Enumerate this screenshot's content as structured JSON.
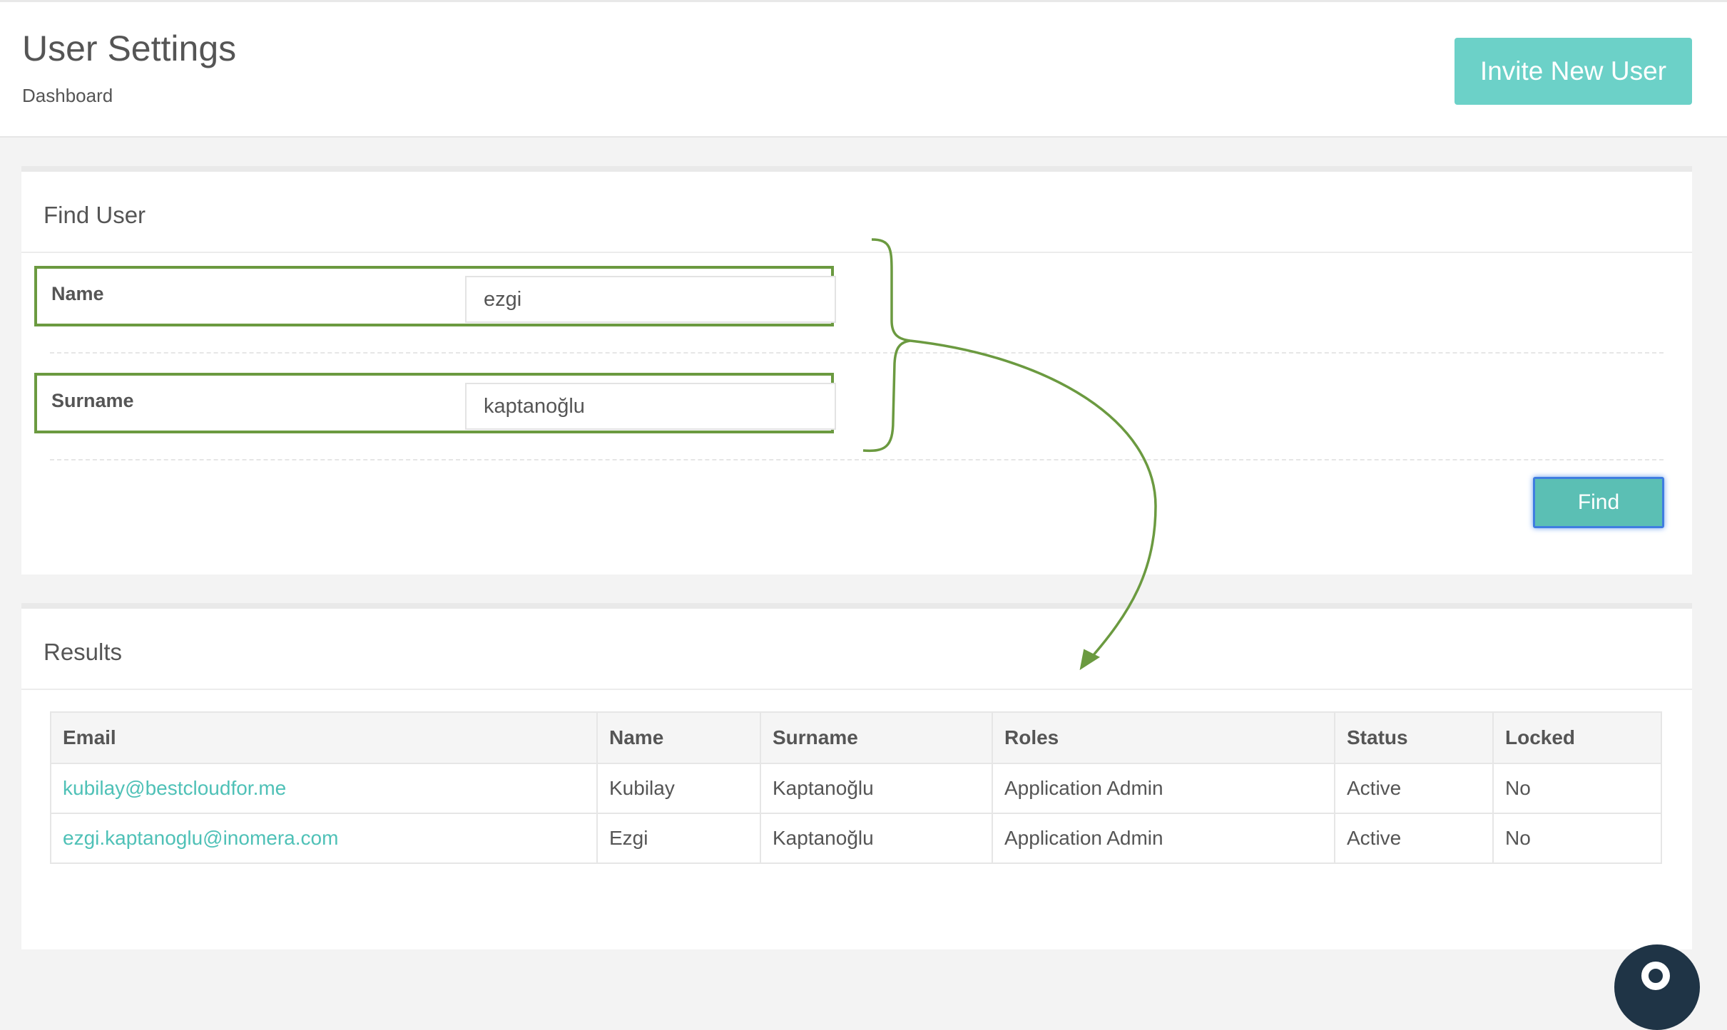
{
  "header": {
    "title": "User Settings",
    "breadcrumb": "Dashboard",
    "invite_button": "Invite New User"
  },
  "find_user": {
    "title": "Find User",
    "fields": [
      {
        "label": "Name",
        "value": "ezgi"
      },
      {
        "label": "Surname",
        "value": "kaptanoğlu"
      }
    ],
    "find_button": "Find"
  },
  "results": {
    "title": "Results",
    "columns": [
      "Email",
      "Name",
      "Surname",
      "Roles",
      "Status",
      "Locked"
    ],
    "rows": [
      [
        "kubilay@bestcloudfor.me",
        "Kubilay",
        "Kaptanoğlu",
        "Application Admin",
        "Active",
        "No"
      ],
      [
        "ezgi.kaptanoglu@inomera.com",
        "Ezgi",
        "Kaptanoğlu",
        "Application Admin",
        "Active",
        "No"
      ]
    ]
  },
  "colors": {
    "accent": "#6cd1c8",
    "link": "#4fc1b7",
    "annotation": "#6b9a40",
    "focus_ring": "#3f7de0"
  },
  "icons": {
    "chat": "chat-bubble-icon"
  }
}
